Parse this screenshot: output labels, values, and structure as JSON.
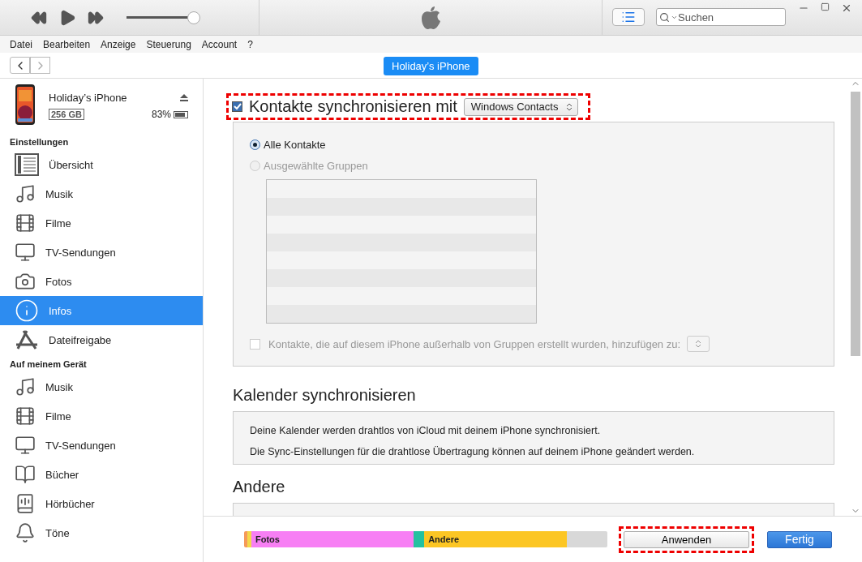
{
  "player": {
    "volume": {
      "level": 0.97
    }
  },
  "search": {
    "placeholder": "Suchen"
  },
  "menu": [
    "Datei",
    "Bearbeiten",
    "Anzeige",
    "Steuerung",
    "Account",
    "?"
  ],
  "nav": {
    "back_disabled": false,
    "forward_disabled": true,
    "device_button": "Holiday’s iPhone"
  },
  "device": {
    "name": "Holiday’s iPhone",
    "capacity": "256 GB",
    "battery": "83%"
  },
  "sidebar": [
    {
      "title": "Einstellungen",
      "items": [
        {
          "label": "Übersicht",
          "kind": "summary",
          "selected": false
        },
        {
          "label": "Musik",
          "kind": "music",
          "selected": false
        },
        {
          "label": "Filme",
          "kind": "film",
          "selected": false
        },
        {
          "label": "TV-Sendungen",
          "kind": "tv",
          "selected": false
        },
        {
          "label": "Fotos",
          "kind": "camera",
          "selected": false
        },
        {
          "label": "Infos",
          "kind": "info",
          "selected": true
        },
        {
          "label": "Dateifreigabe",
          "kind": "apps",
          "selected": false
        }
      ]
    },
    {
      "title": "Auf meinem Gerät",
      "items": [
        {
          "label": "Musik",
          "kind": "music",
          "selected": false
        },
        {
          "label": "Filme",
          "kind": "film",
          "selected": false
        },
        {
          "label": "TV-Sendungen",
          "kind": "tv",
          "selected": false
        },
        {
          "label": "Bücher",
          "kind": "book",
          "selected": false
        },
        {
          "label": "Hörbücher",
          "kind": "audiobook",
          "selected": false
        },
        {
          "label": "Töne",
          "kind": "bell",
          "selected": false
        }
      ]
    }
  ],
  "contacts": {
    "checked": true,
    "label": "Kontakte synchronisieren mit",
    "source": "Windows Contacts",
    "options": [
      {
        "label": "Alle Kontakte",
        "selected": true,
        "disabled": false
      },
      {
        "label": "Ausgewählte Gruppen",
        "selected": false,
        "disabled": true
      }
    ],
    "add_option": {
      "label": "Kontakte, die auf diesem iPhone außerhalb von Gruppen erstellt wurden, hinzufügen zu:",
      "checked": false,
      "disabled": true
    }
  },
  "calendar": {
    "title": "Kalender synchronisieren",
    "lines": [
      "Deine Kalender werden drahtlos von iCloud mit deinem iPhone synchronisiert.",
      "Die Sync-Einstellungen für die drahtlose Übertragung können auf deinem iPhone geändert werden."
    ]
  },
  "other": {
    "title": "Andere"
  },
  "storage": [
    {
      "color": "#f59a5a"
    },
    {
      "color": "#f3d94a"
    },
    {
      "label": "Fotos",
      "color": "#f77ff4"
    },
    {
      "color": "#25c1a0"
    },
    {
      "label": "Andere",
      "color": "#fcc624"
    },
    {
      "color": "#d8d8d8"
    }
  ],
  "buttons": {
    "apply": "Anwenden",
    "done": "Fertig"
  }
}
